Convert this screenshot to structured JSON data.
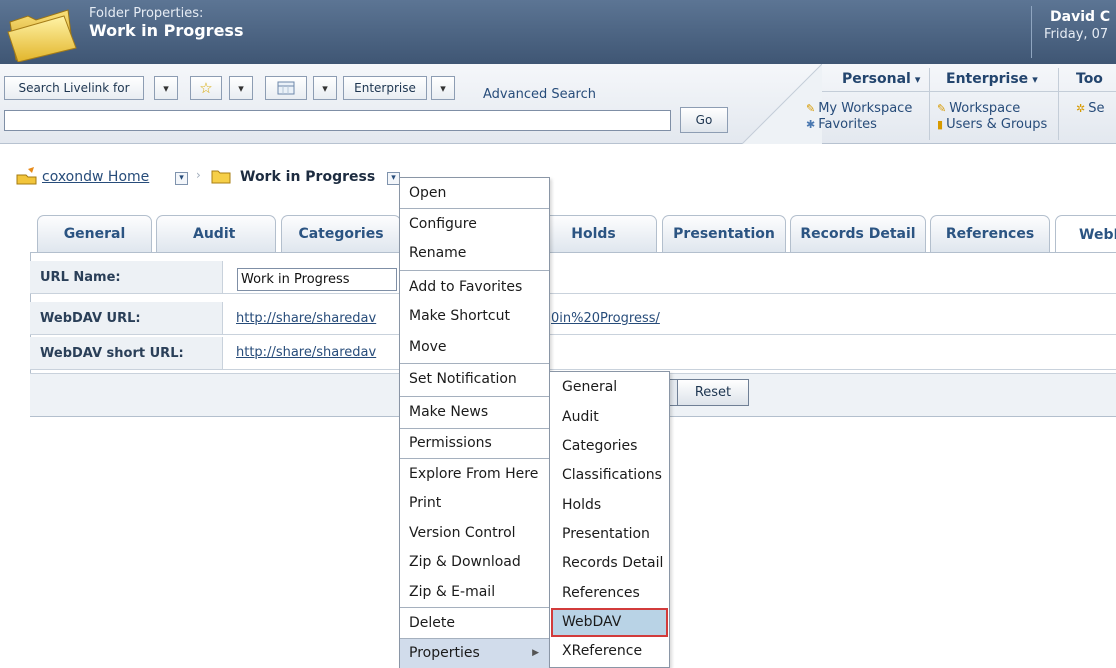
{
  "header": {
    "title_small": "Folder Properties:",
    "title": "Work in Progress",
    "user_name": "David C",
    "date": "Friday, 07"
  },
  "toolbar": {
    "search_for": "Search Livelink for",
    "scope": "Enterprise",
    "advanced_search": "Advanced Search",
    "search_value": "",
    "go_label": "Go",
    "menus": {
      "personal": {
        "label": "Personal",
        "links": [
          "My Workspace",
          "Favorites"
        ]
      },
      "enterprise": {
        "label": "Enterprise",
        "links": [
          "Workspace",
          "Users & Groups"
        ]
      },
      "tools": {
        "label": "Too",
        "links": [
          "Se"
        ]
      }
    }
  },
  "breadcrumb": {
    "home": "coxondw Home",
    "current": "Work in Progress"
  },
  "tabs": [
    {
      "label": "General"
    },
    {
      "label": "Audit"
    },
    {
      "label": "Categories"
    },
    {
      "label": "Holds"
    },
    {
      "label": "Presentation"
    },
    {
      "label": "Records Detail"
    },
    {
      "label": "References"
    },
    {
      "label": "WebD"
    }
  ],
  "form": {
    "url_name_label": "URL Name:",
    "url_name_value": "Work in Progress",
    "webdav_url_label": "WebDAV URL:",
    "webdav_url_left": "http://share/sharedav",
    "webdav_url_right": "0in%20Progress/",
    "webdav_short_label": "WebDAV short URL:",
    "webdav_short_left": "http://share/sharedav",
    "reset_label": "Reset"
  },
  "context_menu": {
    "items": [
      "Open",
      "Configure",
      "Rename",
      "Add to Favorites",
      "Make Shortcut",
      "Move",
      "Set Notification",
      "Make News",
      "Permissions",
      "Explore From Here",
      "Print",
      "Version Control",
      "Zip & Download",
      "Zip & E-mail",
      "Delete",
      "Properties"
    ]
  },
  "sub_menu": {
    "items": [
      "General",
      "Audit",
      "Categories",
      "Classifications",
      "Holds",
      "Presentation",
      "Records Detail",
      "References",
      "WebDAV",
      "XReference"
    ]
  },
  "colors": {
    "header_bg": "#4d6584",
    "tab_text": "#2b5482",
    "selection_outline": "#d23b3b",
    "selection_fill": "#b9d3e6"
  }
}
